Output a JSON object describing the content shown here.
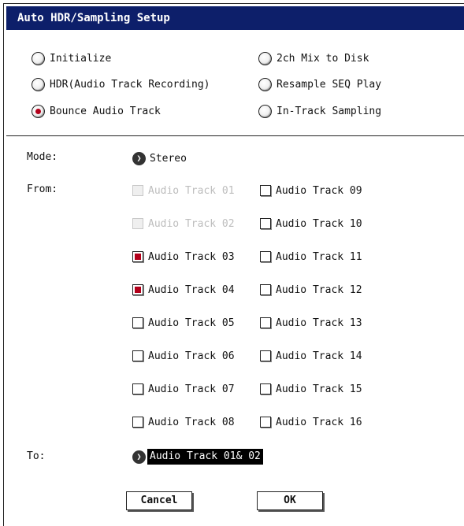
{
  "dialog": {
    "title": "Auto HDR/Sampling Setup"
  },
  "radios": [
    {
      "label": "Initialize",
      "selected": false
    },
    {
      "label": "2ch Mix to Disk",
      "selected": false
    },
    {
      "label": "HDR(Audio Track Recording)",
      "selected": false
    },
    {
      "label": "Resample SEQ Play",
      "selected": false
    },
    {
      "label": "Bounce Audio Track",
      "selected": true
    },
    {
      "label": "In-Track Sampling",
      "selected": false
    }
  ],
  "mode": {
    "label": "Mode:",
    "value": "Stereo",
    "icon": "chevron-right-icon"
  },
  "from": {
    "label": "From:",
    "tracks": [
      {
        "label": "Audio Track 01",
        "checked": false,
        "disabled": true
      },
      {
        "label": "Audio Track 02",
        "checked": false,
        "disabled": true
      },
      {
        "label": "Audio Track 03",
        "checked": true,
        "disabled": false
      },
      {
        "label": "Audio Track 04",
        "checked": true,
        "disabled": false
      },
      {
        "label": "Audio Track 05",
        "checked": false,
        "disabled": false
      },
      {
        "label": "Audio Track 06",
        "checked": false,
        "disabled": false
      },
      {
        "label": "Audio Track 07",
        "checked": false,
        "disabled": false
      },
      {
        "label": "Audio Track 08",
        "checked": false,
        "disabled": false
      },
      {
        "label": "Audio Track 09",
        "checked": false,
        "disabled": false
      },
      {
        "label": "Audio Track 10",
        "checked": false,
        "disabled": false
      },
      {
        "label": "Audio Track 11",
        "checked": false,
        "disabled": false
      },
      {
        "label": "Audio Track 12",
        "checked": false,
        "disabled": false
      },
      {
        "label": "Audio Track 13",
        "checked": false,
        "disabled": false
      },
      {
        "label": "Audio Track 14",
        "checked": false,
        "disabled": false
      },
      {
        "label": "Audio Track 15",
        "checked": false,
        "disabled": false
      },
      {
        "label": "Audio Track 16",
        "checked": false,
        "disabled": false
      }
    ]
  },
  "to": {
    "label": "To:",
    "value": "Audio Track 01& 02",
    "icon": "chevron-right-icon"
  },
  "buttons": {
    "cancel": "Cancel",
    "ok": "OK"
  },
  "colors": {
    "titlebar": "#0d1f6a",
    "selected": "#b3001b"
  }
}
